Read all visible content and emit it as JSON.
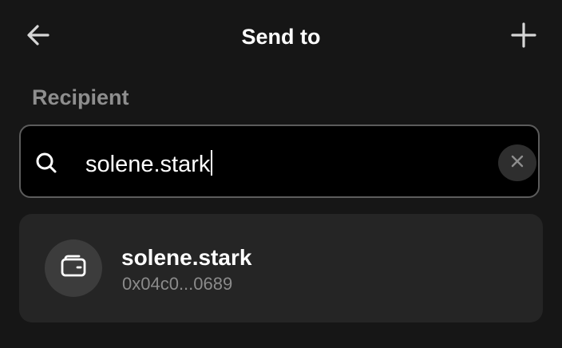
{
  "header": {
    "title": "Send to",
    "back_icon": "arrow-left-icon",
    "add_icon": "plus-icon"
  },
  "recipient": {
    "label": "Recipient"
  },
  "search": {
    "value": "solene.stark",
    "search_icon": "search-icon",
    "clear_icon": "close-icon"
  },
  "results": [
    {
      "name": "solene.stark",
      "address": "0x04c0...0689",
      "icon": "wallet-icon"
    }
  ],
  "colors": {
    "background": "#161616",
    "input_background": "#000000",
    "input_border": "#5c5c5c",
    "card_background": "#252525",
    "muted_text": "#8e8e8e"
  }
}
